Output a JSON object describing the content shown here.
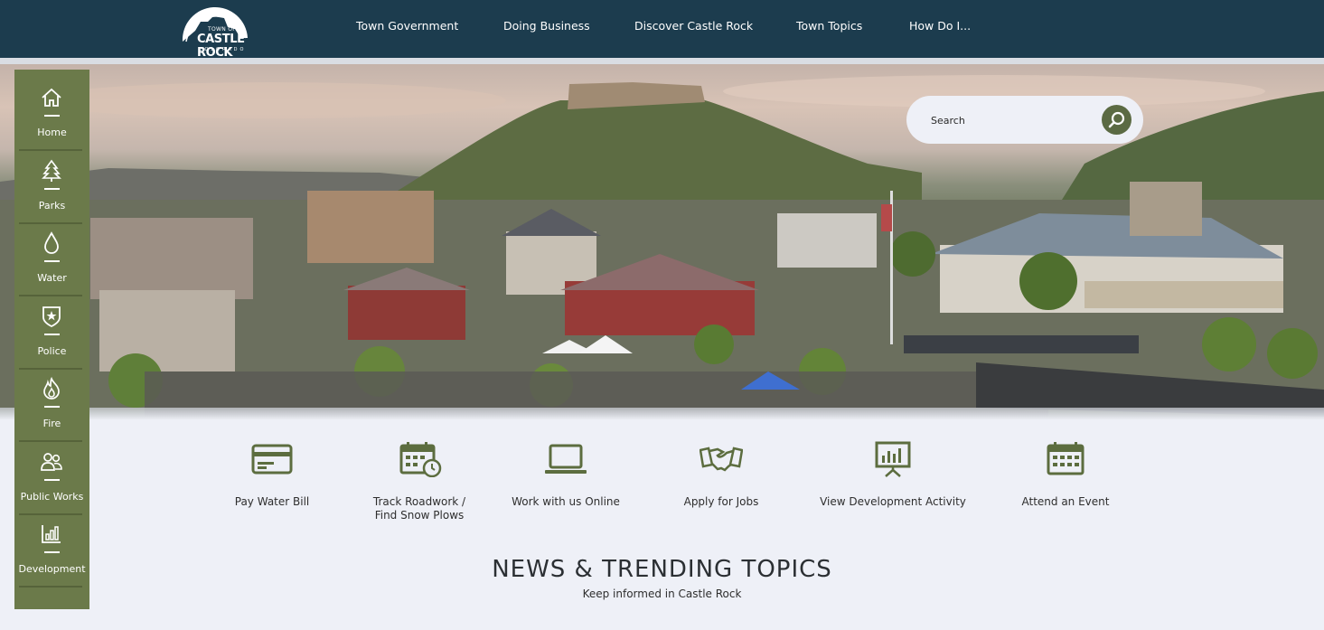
{
  "brand": {
    "logo_line1": "TOWN OF",
    "logo_line2": "CASTLE ROCK",
    "logo_line3": "COLORADO",
    "primary_color": "#1c3c4e",
    "accent_color": "#6b7a4a"
  },
  "nav": {
    "items": [
      {
        "label": "Town Government"
      },
      {
        "label": "Doing Business"
      },
      {
        "label": "Discover Castle Rock"
      },
      {
        "label": "Town Topics"
      },
      {
        "label": "How Do I..."
      }
    ]
  },
  "search": {
    "placeholder": "Search",
    "icon": "magnifier-icon"
  },
  "sidebar": {
    "items": [
      {
        "label": "Home",
        "icon": "home-icon"
      },
      {
        "label": "Parks",
        "icon": "tree-icon"
      },
      {
        "label": "Water",
        "icon": "water-drop-icon"
      },
      {
        "label": "Police",
        "icon": "police-badge-icon"
      },
      {
        "label": "Fire",
        "icon": "fire-icon"
      },
      {
        "label": "Public Works",
        "icon": "people-icon"
      },
      {
        "label": "Development",
        "icon": "bar-chart-icon"
      }
    ]
  },
  "quick_links": [
    {
      "label": "Pay Water Bill",
      "icon": "card-icon"
    },
    {
      "label": "Track Roadwork /\nFind Snow Plows",
      "label_line1": "Track Roadwork /",
      "label_line2": "Find Snow Plows",
      "icon": "calendar-clock-icon"
    },
    {
      "label": "Work with us Online",
      "icon": "laptop-icon"
    },
    {
      "label": "Apply for Jobs",
      "icon": "handshake-icon"
    },
    {
      "label": "View Development Activity",
      "icon": "presentation-chart-icon"
    },
    {
      "label": "Attend an Event",
      "icon": "calendar-icon"
    }
  ],
  "news": {
    "title": "NEWS & TRENDING TOPICS",
    "subtitle": "Keep informed in Castle Rock"
  }
}
